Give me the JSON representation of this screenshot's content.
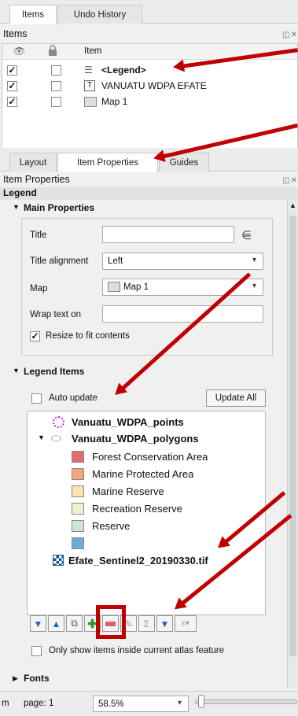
{
  "top_tabs": [
    "Items",
    "Undo History"
  ],
  "items_panel": {
    "title": "Items",
    "ctrls": "◫✕",
    "column_item": "Item",
    "rows": [
      {
        "label": "<Legend>",
        "bold": true,
        "icon": "legend-icon"
      },
      {
        "label": "VANUATU WDPA EFATE",
        "bold": false,
        "icon": "text-label-icon"
      },
      {
        "label": "Map 1",
        "bold": false,
        "icon": "map-icon"
      }
    ]
  },
  "mid_tabs": [
    "Layout",
    "Item Properties",
    "Guides"
  ],
  "item_props": {
    "title": "Item Properties",
    "ctrls": "◫✕",
    "header": "Legend",
    "main_properties": "Main Properties",
    "title_label": "Title",
    "title_value": "",
    "align_label": "Title alignment",
    "align_value": "Left",
    "map_label": "Map",
    "map_value": "Map 1",
    "wrap_label": "Wrap text on",
    "wrap_value": "",
    "resize_label": "Resize to fit contents",
    "legend_items": "Legend Items",
    "auto_update": "Auto update",
    "update_all": "Update All",
    "layers": {
      "points": "Vanuatu_WDPA_points",
      "polygons": "Vanuatu_WDPA_polygons",
      "classes": [
        {
          "label": "Forest Conservation Area",
          "color": "#e36d6d"
        },
        {
          "label": "Marine Protected Area",
          "color": "#f2a77e"
        },
        {
          "label": "Marine Reserve",
          "color": "#fbe3b3"
        },
        {
          "label": "Recreation Reserve",
          "color": "#e7f4cf"
        },
        {
          "label": "Reserve",
          "color": "#c9e7d4"
        },
        {
          "label": "",
          "color": "#6aaed6"
        }
      ],
      "raster": "Efate_Sentinel2_20190330.tif"
    },
    "atlas_only": "Only show items inside current atlas feature",
    "fonts": "Fonts"
  },
  "status": {
    "unit": "m",
    "page": "page: 1",
    "zoom": "58.5%"
  },
  "colors": {
    "highlight": "#c00000"
  }
}
